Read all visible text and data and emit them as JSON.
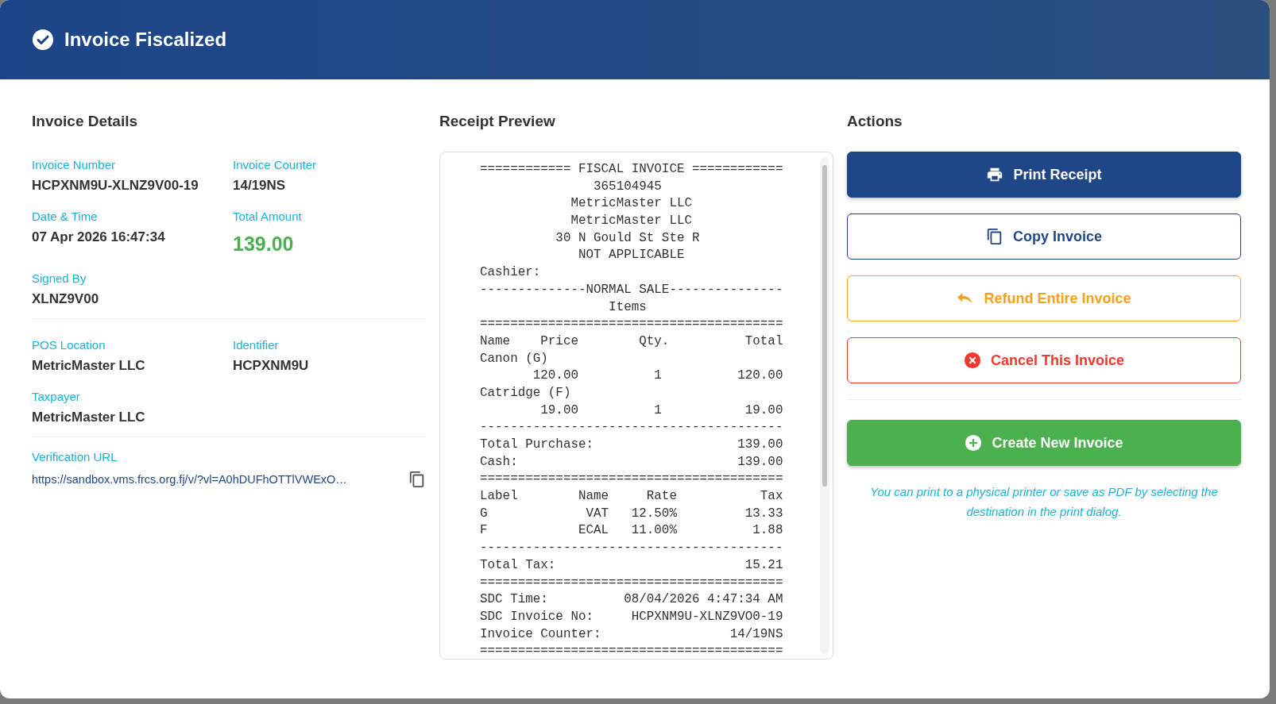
{
  "dialog": {
    "title": "Invoice Fiscalized"
  },
  "details": {
    "heading": "Invoice Details",
    "groups": [
      {
        "fields": [
          {
            "label": "Invoice Number",
            "value": "HCPXNM9U-XLNZ9V00-19",
            "kind": "text"
          },
          {
            "label": "Invoice Counter",
            "value": "14/19NS",
            "kind": "text"
          },
          {
            "label": "Date & Time",
            "value": "07 Apr 2026 16:47:34",
            "kind": "text"
          },
          {
            "label": "Total Amount",
            "value": "139.00",
            "kind": "amount"
          },
          {
            "label": "Signed By",
            "value": "XLNZ9V00",
            "kind": "text"
          }
        ]
      },
      {
        "fields": [
          {
            "label": "POS Location",
            "value": "MetricMaster LLC",
            "kind": "text"
          },
          {
            "label": "Identifier",
            "value": "HCPXNM9U",
            "kind": "text"
          },
          {
            "label": "Taxpayer",
            "value": "MetricMaster LLC",
            "kind": "text"
          }
        ]
      }
    ],
    "verification": {
      "label": "Verification URL",
      "url": "https://sandbox.vms.frcs.org.fj/v/?vl=A0hDUFhOTTlVWExO…"
    }
  },
  "receipt": {
    "heading": "Receipt Preview",
    "lines": [
      "============ FISCAL INVOICE ============",
      "               365104945",
      "            MetricMaster LLC",
      "            MetricMaster LLC",
      "          30 N Gould St Ste R",
      "             NOT APPLICABLE",
      "Cashier:",
      "--------------NORMAL SALE---------------",
      "                 Items",
      "========================================",
      "Name    Price        Qty.          Total",
      "Canon (G)",
      "       120.00          1          120.00",
      "Catridge (F)",
      "        19.00          1           19.00",
      "----------------------------------------",
      "Total Purchase:                   139.00",
      "Cash:                             139.00",
      "========================================",
      "Label        Name     Rate           Tax",
      "G             VAT   12.50%         13.33",
      "F            ECAL   11.00%          1.88",
      "----------------------------------------",
      "Total Tax:                         15.21",
      "========================================",
      "SDC Time:          08/04/2026 4:47:34 AM",
      "SDC Invoice No:     HCPXNM9U-XLNZ9VO0-19",
      "Invoice Counter:                 14/19NS",
      "========================================"
    ]
  },
  "actions": {
    "heading": "Actions",
    "buttons": [
      {
        "label": "Print Receipt",
        "kind": "primary"
      },
      {
        "label": "Copy Invoice",
        "kind": "outline"
      },
      {
        "label": "Refund Entire Invoice",
        "kind": "warning"
      },
      {
        "label": "Cancel This Invoice",
        "kind": "danger"
      },
      {
        "label": "Create New Invoice",
        "kind": "success"
      }
    ],
    "note": "You can print to a physical printer or save as PDF by selecting the destination in the print dialog."
  }
}
